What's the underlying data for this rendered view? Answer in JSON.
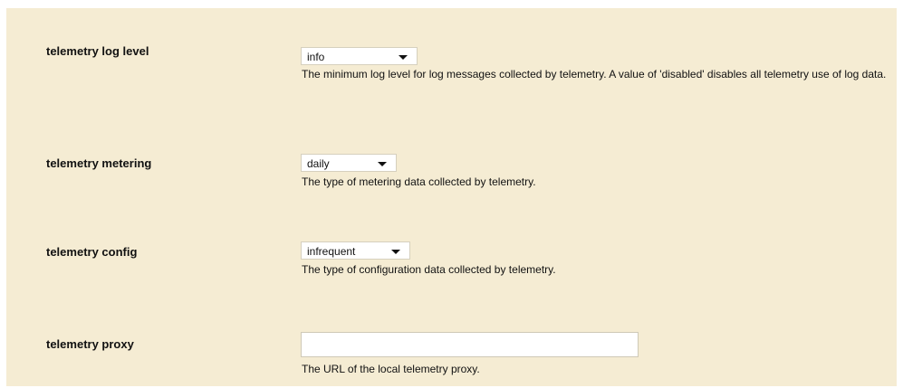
{
  "settings": [
    {
      "label": "telemetry log level",
      "value": "info",
      "description": "The minimum log level for log messages collected by telemetry. A value of 'disabled' disables all telemetry use of log data."
    },
    {
      "label": "telemetry metering",
      "value": "daily",
      "description": "The type of metering data collected by telemetry."
    },
    {
      "label": "telemetry config",
      "value": "infrequent",
      "description": "The type of configuration data collected by telemetry."
    },
    {
      "label": "telemetry proxy",
      "value": "",
      "description": "The URL of the local telemetry proxy."
    }
  ],
  "icons": {
    "dropdown": "chevron-down-icon"
  },
  "colors": {
    "panel_background": "#f5ecd3",
    "text": "#111111"
  }
}
